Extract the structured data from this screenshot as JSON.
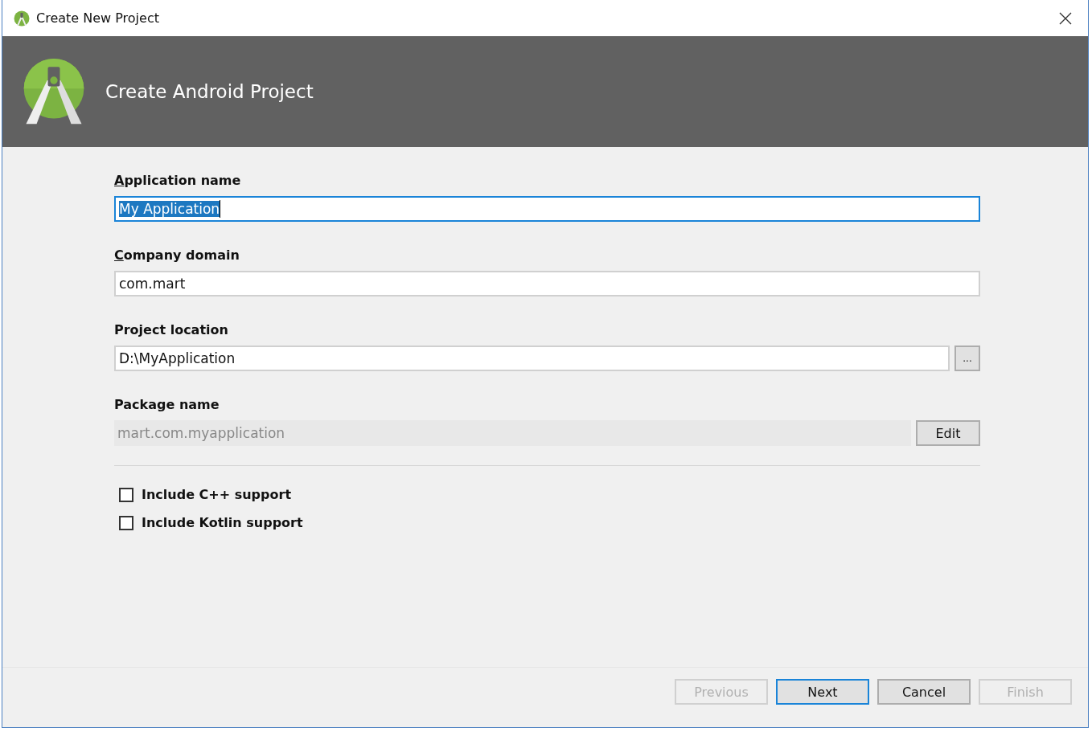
{
  "window": {
    "title": "Create New Project"
  },
  "header": {
    "title": "Create Android Project"
  },
  "fields": [
    {
      "kind": "text",
      "label": "Application name",
      "mnemonic": true,
      "value": "My Application",
      "focused": true,
      "selected": true
    },
    {
      "kind": "text",
      "label": "Company domain",
      "mnemonic": true,
      "value": "com.mart",
      "focused": false,
      "selected": false
    },
    {
      "kind": "browse",
      "label": "Project location",
      "mnemonic": false,
      "value": "D:\\MyApplication",
      "focused": false,
      "selected": false,
      "button": "..."
    },
    {
      "kind": "readonly",
      "label": "Package name",
      "mnemonic": false,
      "value": "mart.com.myapplication",
      "button": "Edit"
    }
  ],
  "options": [
    {
      "label": "Include C++ support",
      "checked": false
    },
    {
      "label": "Include Kotlin support",
      "checked": false
    }
  ],
  "buttons": [
    {
      "label": "Previous",
      "disabled": true,
      "default": false
    },
    {
      "label": "Next",
      "disabled": false,
      "default": true
    },
    {
      "label": "Cancel",
      "disabled": false,
      "default": false
    },
    {
      "label": "Finish",
      "disabled": true,
      "default": false
    }
  ]
}
